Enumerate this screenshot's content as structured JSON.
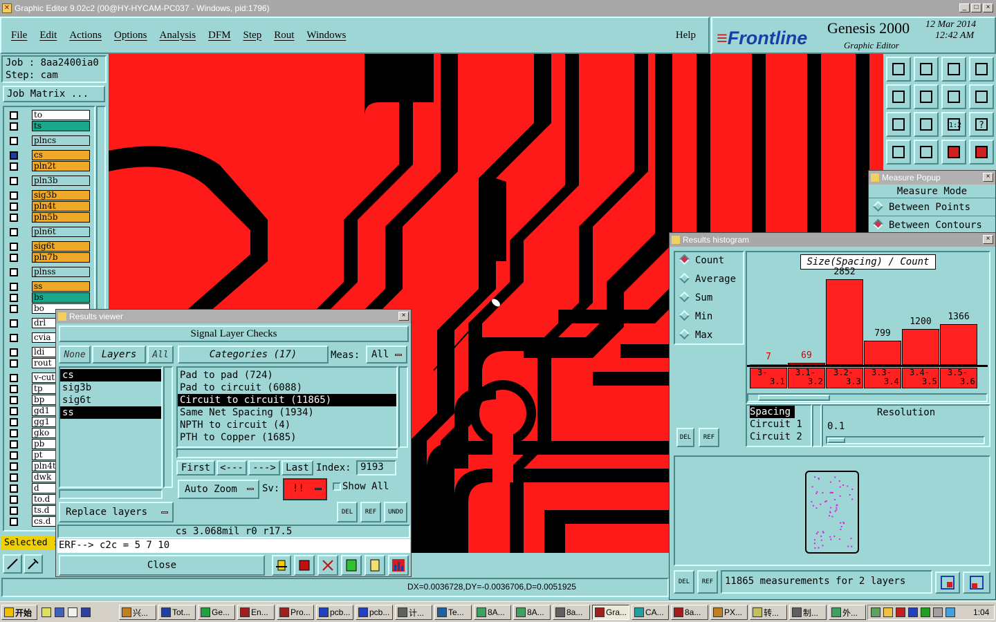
{
  "window": {
    "title": "Graphic Editor 9.02c2 (00@HY-HYCAM-PC037 - Windows, pid:1796)"
  },
  "menu": {
    "items": [
      "File",
      "Edit",
      "Actions",
      "Options",
      "Analysis",
      "DFM",
      "Step",
      "Rout",
      "Windows"
    ],
    "help": "Help"
  },
  "brand": {
    "logo": "Frontline",
    "product": "Genesis 2000",
    "subtitle": "Graphic Editor",
    "date": "12 Mar 2014",
    "time": "12:42 AM"
  },
  "job": {
    "job_label": "Job : 8aa2400ia0",
    "step_label": "Step: cam",
    "matrix_button": "Job Matrix ..."
  },
  "layers": [
    {
      "name": "to",
      "color": "#ffffff"
    },
    {
      "name": "ts",
      "color": "#1aa88c"
    },
    {
      "name": "plncs",
      "color": "#9ed6d6"
    },
    {
      "name": "cs",
      "color": "#f0a828"
    },
    {
      "name": "pln2t",
      "color": "#f0a828"
    },
    {
      "name": "pln3b",
      "color": "#9ed6d6"
    },
    {
      "name": "sig3b",
      "color": "#f0a828"
    },
    {
      "name": "pln4t",
      "color": "#f0a828"
    },
    {
      "name": "pln5b",
      "color": "#f0a828"
    },
    {
      "name": "pln6t",
      "color": "#9ed6d6"
    },
    {
      "name": "sig6t",
      "color": "#f0a828"
    },
    {
      "name": "pln7b",
      "color": "#f0a828"
    },
    {
      "name": "plnss",
      "color": "#9ed6d6"
    },
    {
      "name": "ss",
      "color": "#f0a828"
    },
    {
      "name": "bs",
      "color": "#1aa88c"
    },
    {
      "name": "bo",
      "color": "#ffffff"
    },
    {
      "name": "drl",
      "color": "#ffffff"
    },
    {
      "name": "cvia",
      "color": "#ffffff"
    },
    {
      "name": "ldi",
      "color": "#ffffff"
    },
    {
      "name": "rout",
      "color": "#ffffff"
    },
    {
      "name": "v-cut",
      "color": "#ffffff"
    },
    {
      "name": "tp",
      "color": "#ffffff"
    },
    {
      "name": "bp",
      "color": "#ffffff"
    },
    {
      "name": "gd1",
      "color": "#ffffff"
    },
    {
      "name": "gg1",
      "color": "#ffffff"
    },
    {
      "name": "gko",
      "color": "#ffffff"
    },
    {
      "name": "pb",
      "color": "#ffffff"
    },
    {
      "name": "pt",
      "color": "#ffffff"
    },
    {
      "name": "pln4t",
      "color": "#ffffff"
    },
    {
      "name": "dwk",
      "color": "#ffffff"
    },
    {
      "name": "d",
      "color": "#ffffff"
    },
    {
      "name": "to.d",
      "color": "#ffffff"
    },
    {
      "name": "ts.d",
      "color": "#ffffff"
    },
    {
      "name": "cs.d",
      "color": "#ffffff"
    }
  ],
  "selected_label": "Selected :",
  "results_viewer": {
    "title": "Results viewer",
    "header": "Signal Layer Checks",
    "none": "None",
    "layers": "Layers",
    "all": "All",
    "categories": "Categories (17)",
    "meas_label": "Meas:",
    "meas_value": "All",
    "layer_list": [
      "cs",
      "sig3b",
      "sig6t",
      "ss"
    ],
    "category_list": [
      "Pad to pad (724)",
      "Pad to circuit (6088)",
      "Circuit to circuit (11865)",
      "Same Net Spacing (1934)",
      "NPTH to circuit (4)",
      "PTH to Copper (1685)"
    ],
    "first": "First",
    "prev": "<---",
    "next": "--->",
    "last": "Last",
    "index_label": "Index:",
    "index_value": "9193",
    "auto_zoom": "Auto Zoom",
    "sv_label": "Sv:",
    "sv_value": "!!",
    "show_all": "Show All",
    "replace_layers": "Replace layers",
    "del": "DEL",
    "ref": "REF",
    "undo": "UNDO",
    "info": "cs 3.068mil  r0  r17.5",
    "erf": "ERF--> c2c = 5 7 10",
    "close": "Close"
  },
  "measure_popup": {
    "title": "Measure Popup",
    "mode": "Measure Mode",
    "between_points": "Between Points",
    "between_contours": "Between Contours"
  },
  "histogram": {
    "title": "Results histogram",
    "options": [
      "Count",
      "Average",
      "Sum",
      "Min",
      "Max"
    ],
    "selected_option": "Count",
    "chart_title": "Size(Spacing) / Count",
    "spacing_list": [
      "Spacing",
      "Circuit 1",
      "Circuit 2"
    ],
    "resolution_label": "Resolution",
    "resolution_value": "0.1",
    "del": "DEL",
    "ref": "REF",
    "summary": "11865 measurements for 2 layers"
  },
  "chart_data": {
    "type": "bar",
    "title": "Size(Spacing) / Count",
    "categories": [
      "3-\n3.1",
      "3.1-\n3.2",
      "3.2-\n3.3",
      "3.3-\n3.4",
      "3.4-\n3.5",
      "3.5-\n3.6"
    ],
    "category_labels": [
      [
        "3-",
        "3.1"
      ],
      [
        "3.1-",
        "3.2"
      ],
      [
        "3.2-",
        "3.3"
      ],
      [
        "3.3-",
        "3.4"
      ],
      [
        "3.4-",
        "3.5"
      ],
      [
        "3.5-",
        "3.6"
      ]
    ],
    "values": [
      7,
      69,
      2852,
      799,
      1200,
      1366
    ],
    "ylim": [
      0,
      2852
    ]
  },
  "status": {
    "coords": "DX=0.0036728,DY=-0.0036706,D=0.0051925"
  },
  "taskbar": {
    "start": "开始",
    "items": [
      "兴...",
      "Tot...",
      "Ge...",
      "En...",
      "Pro...",
      "pcb...",
      "pcb...",
      "计...",
      "Te...",
      "8A...",
      "8A...",
      "8a...",
      "Gra...",
      "CA...",
      "8a...",
      "PX...",
      "转...",
      "制...",
      "外..."
    ],
    "clock": "1:04"
  },
  "colors": {
    "teal": "#9ed6d6",
    "canvas": "#ff1a1a",
    "accent": "#d0304a"
  }
}
